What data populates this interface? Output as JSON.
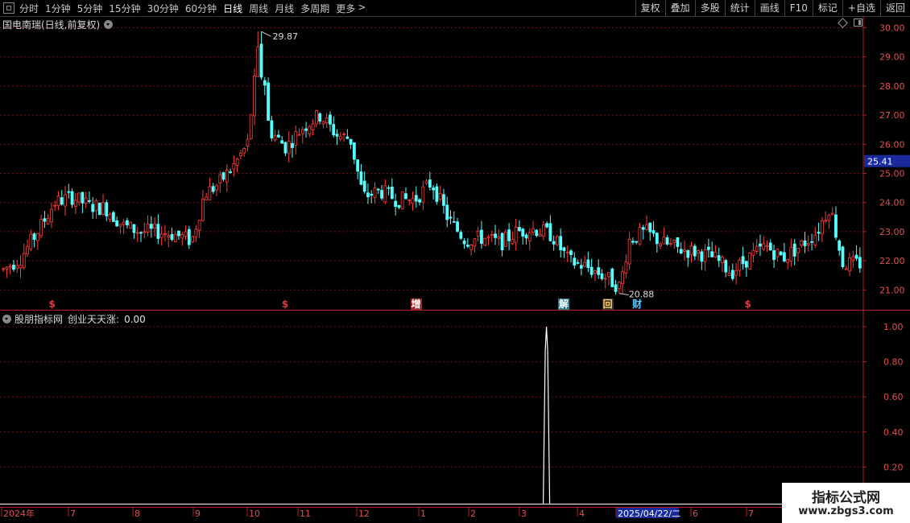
{
  "toolbar": {
    "periods": [
      "分时",
      "1分钟",
      "5分钟",
      "15分钟",
      "30分钟",
      "60分钟",
      "日线",
      "周线",
      "月线",
      "多周期",
      "更多"
    ],
    "active_period": "日线",
    "more_arrow": ">",
    "buttons": [
      "复权",
      "叠加",
      "多股",
      "统计",
      "画线",
      "F10",
      "标记",
      "+自选",
      "返回"
    ]
  },
  "main_chart": {
    "title": "国电南瑞(日线,前复权)",
    "price_labels": [
      "30.00",
      "29.00",
      "28.00",
      "27.00",
      "26.00",
      "25.00",
      "24.00",
      "23.00",
      "22.00",
      "21.00"
    ],
    "current_price": "25.41",
    "high_label": "29.87",
    "low_label": "20.88",
    "event_markers": [
      {
        "text": "$",
        "color": "#e03c3c",
        "t": 0.062
      },
      {
        "text": "$",
        "color": "#e03c3c",
        "t": 0.332
      },
      {
        "text": "增",
        "color": "#ffffff",
        "bg": "#a02828",
        "t": 0.481
      },
      {
        "text": "解",
        "color": "#ffffff",
        "bg": "#2a7a8a",
        "t": 0.652
      },
      {
        "text": "回",
        "color": "#ffcc66",
        "bg": "#333333",
        "t": 0.703
      },
      {
        "text": "财",
        "color": "#66c8ff",
        "t": 0.738
      },
      {
        "text": "$",
        "color": "#e03c3c",
        "t": 0.868
      }
    ]
  },
  "indicator": {
    "source": "股朋指标网",
    "name": "创业天天涨",
    "value": "0.00",
    "axis_labels": [
      "1.00",
      "0.80",
      "0.60",
      "0.40",
      "0.20"
    ]
  },
  "date_axis": {
    "labels": [
      "2024年",
      "7",
      "8",
      "9",
      "10",
      "11",
      "12",
      "1",
      "2",
      "3",
      "4",
      "2025/04/22/二",
      "6",
      "7"
    ]
  },
  "watermark": {
    "line1": "指标公式网",
    "line2": "www.zbgs3.com"
  },
  "colors": {
    "up": "#ff3c3c",
    "down": "#54ffff",
    "grid": "#7a1010",
    "border": "#b02020",
    "signal": "#ffffff"
  },
  "chart_data": {
    "type": "candlestick",
    "price_range": [
      20.6,
      30.3
    ],
    "price_path": [
      [
        0.0,
        21.7
      ],
      [
        0.02,
        22.1
      ],
      [
        0.04,
        23.0
      ],
      [
        0.06,
        24.0
      ],
      [
        0.08,
        24.2
      ],
      [
        0.1,
        23.9
      ],
      [
        0.12,
        23.8
      ],
      [
        0.14,
        23.2
      ],
      [
        0.16,
        23.0
      ],
      [
        0.18,
        23.0
      ],
      [
        0.2,
        22.9
      ],
      [
        0.22,
        22.7
      ],
      [
        0.235,
        24.3
      ],
      [
        0.25,
        24.6
      ],
      [
        0.27,
        25.3
      ],
      [
        0.285,
        26.0
      ],
      [
        0.3,
        29.87
      ],
      [
        0.31,
        26.5
      ],
      [
        0.33,
        25.9
      ],
      [
        0.35,
        26.6
      ],
      [
        0.37,
        27.0
      ],
      [
        0.39,
        26.3
      ],
      [
        0.405,
        26.2
      ],
      [
        0.42,
        24.2
      ],
      [
        0.44,
        24.4
      ],
      [
        0.46,
        24.1
      ],
      [
        0.48,
        24.1
      ],
      [
        0.5,
        24.7
      ],
      [
        0.52,
        23.4
      ],
      [
        0.54,
        22.7
      ],
      [
        0.56,
        22.8
      ],
      [
        0.58,
        22.6
      ],
      [
        0.6,
        23.0
      ],
      [
        0.62,
        23.1
      ],
      [
        0.64,
        22.9
      ],
      [
        0.66,
        22.0
      ],
      [
        0.68,
        21.8
      ],
      [
        0.7,
        21.5
      ],
      [
        0.72,
        21.1
      ],
      [
        0.73,
        22.7
      ],
      [
        0.75,
        23.0
      ],
      [
        0.77,
        22.6
      ],
      [
        0.79,
        22.4
      ],
      [
        0.81,
        22.3
      ],
      [
        0.83,
        22.1
      ],
      [
        0.85,
        21.6
      ],
      [
        0.87,
        22.1
      ],
      [
        0.89,
        22.5
      ],
      [
        0.91,
        22.1
      ],
      [
        0.93,
        22.5
      ],
      [
        0.95,
        23.0
      ],
      [
        0.965,
        23.9
      ],
      [
        0.98,
        21.9
      ],
      [
        1.0,
        21.9
      ]
    ],
    "indicator_signal": {
      "t": 0.633,
      "value": 1.0
    },
    "indicator_range": [
      0,
      1.0
    ]
  }
}
